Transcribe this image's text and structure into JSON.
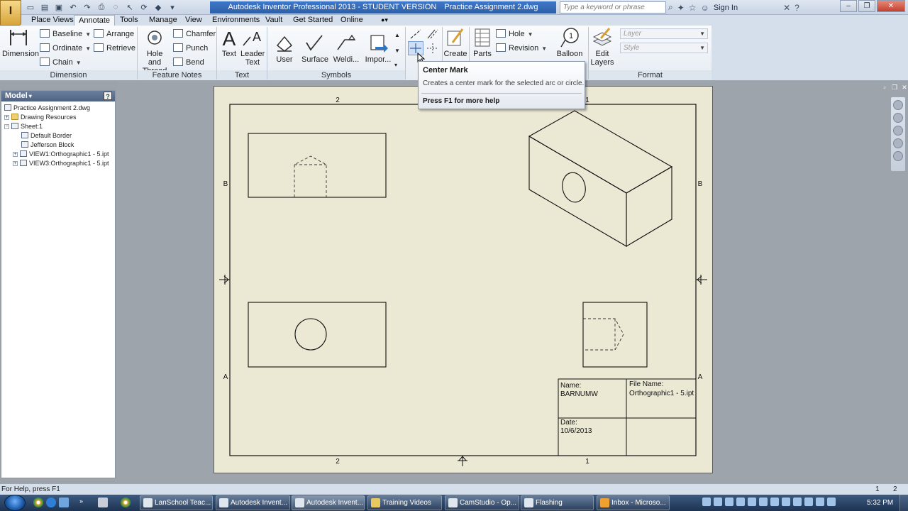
{
  "titlebar": {
    "app_name": "Autodesk Inventor Professional 2013 - STUDENT VERSION",
    "document": "Practice Assignment 2.dwg",
    "search_placeholder": "Type a keyword or phrase",
    "sign_in": "Sign In",
    "app_button_label": "I"
  },
  "tabs": [
    "Place Views",
    "Annotate",
    "Tools",
    "Manage",
    "View",
    "Environments",
    "Vault",
    "Get Started",
    "Online"
  ],
  "active_tab": "Annotate",
  "ribbon": {
    "dimension_panel": {
      "label": "Dimension",
      "dimension": "Dimension",
      "baseline": "Baseline",
      "ordinate": "Ordinate",
      "chain": "Chain",
      "arrange": "Arrange",
      "retrieve": "Retrieve"
    },
    "feature_notes_panel": {
      "label": "Feature Notes",
      "hole_thread_1": "Hole and",
      "hole_thread_2": "Thread",
      "chamfer": "Chamfer",
      "punch": "Punch",
      "bend": "Bend"
    },
    "text_panel": {
      "label": "Text",
      "text": "Text",
      "leader_1": "Leader",
      "leader_2": "Text"
    },
    "symbols_panel": {
      "label": "Symbols",
      "user": "User",
      "surface": "Surface",
      "welding": "Weldi...",
      "import": "Impor..."
    },
    "sketch_panel": {
      "create": "Create"
    },
    "table_panel": {
      "parts": "Parts",
      "hole": "Hole",
      "revision": "Revision",
      "balloon": "Balloon"
    },
    "format_panel": {
      "label": "Format",
      "edit_layers_1": "Edit",
      "edit_layers_2": "Layers",
      "layer_placeholder": "Layer",
      "style_placeholder": "Style"
    }
  },
  "tooltip": {
    "title": "Center Mark",
    "description": "Creates a center mark for the selected arc or circle.",
    "help": "Press F1 for more help"
  },
  "browser": {
    "header": "Model",
    "help_glyph": "?",
    "items": [
      {
        "label": "Practice Assignment 2.dwg",
        "indent": 0
      },
      {
        "label": "Drawing Resources",
        "indent": 1
      },
      {
        "label": "Sheet:1",
        "indent": 1
      },
      {
        "label": "Default Border",
        "indent": 2
      },
      {
        "label": "Jefferson Block",
        "indent": 2
      },
      {
        "label": "VIEW1:Orthographic1 - 5.ipt",
        "indent": 2
      },
      {
        "label": "VIEW3:Orthographic1 - 5.ipt",
        "indent": 2
      }
    ]
  },
  "sheet": {
    "zone_top_left": "2",
    "zone_top_right": "1",
    "zone_bottom_left": "2",
    "zone_bottom_right": "1",
    "zone_left_upper": "B",
    "zone_left_lower": "A",
    "zone_right_upper": "B",
    "zone_right_lower": "A",
    "title_block": {
      "name_label": "Name:",
      "name_value": "BARNUMW",
      "file_label": "File Name:",
      "file_value": "Orthographic1 - 5.ipt",
      "date_label": "Date:",
      "date_value": "10/6/2013"
    }
  },
  "statusbar": {
    "help_text": "For Help, press F1",
    "count_1": "1",
    "count_2": "2"
  },
  "taskbar": {
    "buttons": [
      {
        "label": "LanSchool Teac...",
        "active": false
      },
      {
        "label": "Autodesk Invent...",
        "active": false
      },
      {
        "label": "Autodesk Invent...",
        "active": true
      },
      {
        "label": "Training Videos",
        "active": false
      },
      {
        "label": "CamStudio - Op...",
        "active": false
      },
      {
        "label": "Flashing",
        "active": false
      },
      {
        "label": "Inbox - Microso...",
        "active": false
      }
    ],
    "clock": "5:32 PM"
  },
  "colors": {
    "sheet_background": "#ebe8d4",
    "title_accent": "#2d5fa8",
    "drawing_line": "#111111",
    "canvas_background": "#9ea4ac"
  }
}
